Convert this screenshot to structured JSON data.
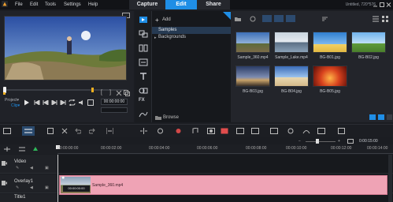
{
  "menu": {
    "file": "File",
    "edit": "Edit",
    "tools": "Tools",
    "settings": "Settings",
    "help": "Help"
  },
  "modes": {
    "capture": "Capture",
    "edit": "Edit",
    "share": "Share"
  },
  "project": {
    "title": "Untitled, 720*576"
  },
  "preview": {
    "project_label": "Project▾",
    "clip_label": "Clip▾",
    "timecode": "00:00:00:00"
  },
  "library": {
    "add_label": "Add",
    "folders": [
      "Samples",
      "Backgrounds"
    ],
    "browse_label": "Browse"
  },
  "thumbs": [
    {
      "name": "Sample_360.mp4"
    },
    {
      "name": "Sample_Lake.mp4"
    },
    {
      "name": "BG-B01.jpg"
    },
    {
      "name": "BG-B02.jpg"
    },
    {
      "name": "BG-B03.jpg"
    },
    {
      "name": "BG-B04.jpg"
    },
    {
      "name": "BG-B05.jpg"
    }
  ],
  "timeline": {
    "ticks": [
      "00:00:00:00",
      "00:00:02:00",
      "00:00:04:00",
      "00:00:06:00",
      "00:00:08:00",
      "00:00:10:00",
      "00:00:12:00",
      "00:00:14:00"
    ],
    "zoom_time": "0:00:15:00",
    "tracks": [
      {
        "name": "Video"
      },
      {
        "name": "Overlay1"
      },
      {
        "name": "Title1"
      }
    ],
    "clip": {
      "name": "Sample_360.mp4",
      "timecode": "00:00:00:00"
    }
  },
  "colors": {
    "accent": "#1f8ee6",
    "clip": "#efa3b5",
    "background": "#1b1d22"
  }
}
